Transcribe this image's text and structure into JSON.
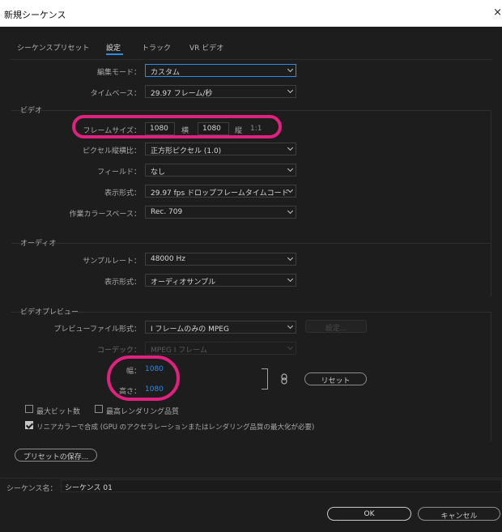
{
  "window": {
    "title": "新規シーケンス",
    "close_glyph": "×"
  },
  "tabs": [
    "シーケンスプリセット",
    "設定",
    "トラック",
    "VR ビデオ"
  ],
  "general": {
    "edit_mode_label": "編集モード：",
    "edit_mode_value": "カスタム",
    "timebase_label": "タイムベース：",
    "timebase_value": "29.97  フレーム/秒"
  },
  "video": {
    "section_title": "ビデオ",
    "frame_size_label": "フレームサイズ：",
    "frame_width": "1080",
    "horizontal_label": "横",
    "frame_height": "1080",
    "vertical_label": "縦",
    "aspect": "1:1",
    "pixel_aspect_label": "ピクセル縦横比：",
    "pixel_aspect_value": "正方形ピクセル (1.0)",
    "field_label": "フィールド：",
    "field_value": "なし",
    "display_format_label": "表示形式：",
    "display_format_value": "29.97 fps ドロップフレームタイムコード",
    "color_space_label": "作業カラースペース：",
    "color_space_value": "Rec. 709"
  },
  "audio": {
    "section_title": "オーディオ",
    "sample_rate_label": "サンプルレート：",
    "sample_rate_value": "48000 Hz",
    "display_format_label": "表示形式：",
    "display_format_value": "オーディオサンプル"
  },
  "preview": {
    "section_title": "ビデオプレビュー",
    "file_format_label": "プレビューファイル形式：",
    "file_format_value": "I フレームのみの MPEG",
    "settings_button": "設定...",
    "codec_label": "コーデック：",
    "codec_value": "MPEG I フレーム",
    "width_label": "幅：",
    "width_value": "1080",
    "height_label": "高さ：",
    "height_value": "1080",
    "reset_button": "リセット"
  },
  "options": {
    "max_bit_depth": "最大ビット数",
    "max_render_quality": "最高レンダリング品質",
    "linear_color": "リニアカラーで合成 (GPU のアクセラレーションまたはレンダリング品質の最大化が必要)",
    "linear_color_checked": true
  },
  "save_preset_button": "プリセットの保存...",
  "sequence_name_label": "シーケンス名：",
  "sequence_name_value": "シーケンス 01",
  "ok_button": "OK",
  "cancel_button": "キャンセル",
  "colors": {
    "accent": "#2d8ceb",
    "highlight": "#e0217f",
    "background": "#1d1d1d"
  }
}
